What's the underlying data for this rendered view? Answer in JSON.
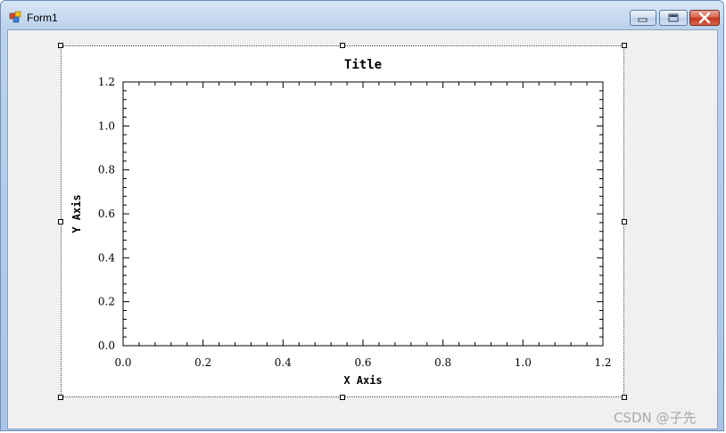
{
  "window": {
    "title": "Form1"
  },
  "colors": {
    "titlebar": "#bcd2ec",
    "client_bg": "#f0f0f0",
    "close_button": "#c2351b"
  },
  "icons": [
    "app-form-icon",
    "minimize-icon",
    "maximize-icon",
    "close-icon"
  ],
  "chart_data": {
    "type": "line",
    "title": "Title",
    "xlabel": "X Axis",
    "ylabel": "Y Axis",
    "xlim": [
      0.0,
      1.2
    ],
    "ylim": [
      0.0,
      1.2
    ],
    "x_ticks": [
      "0.0",
      "0.2",
      "0.4",
      "0.6",
      "0.8",
      "1.0",
      "1.2"
    ],
    "y_ticks": [
      "0.0",
      "0.2",
      "0.4",
      "0.6",
      "0.8",
      "1.0",
      "1.2"
    ],
    "series": [],
    "grid": false
  },
  "watermark": "CSDN @子先"
}
